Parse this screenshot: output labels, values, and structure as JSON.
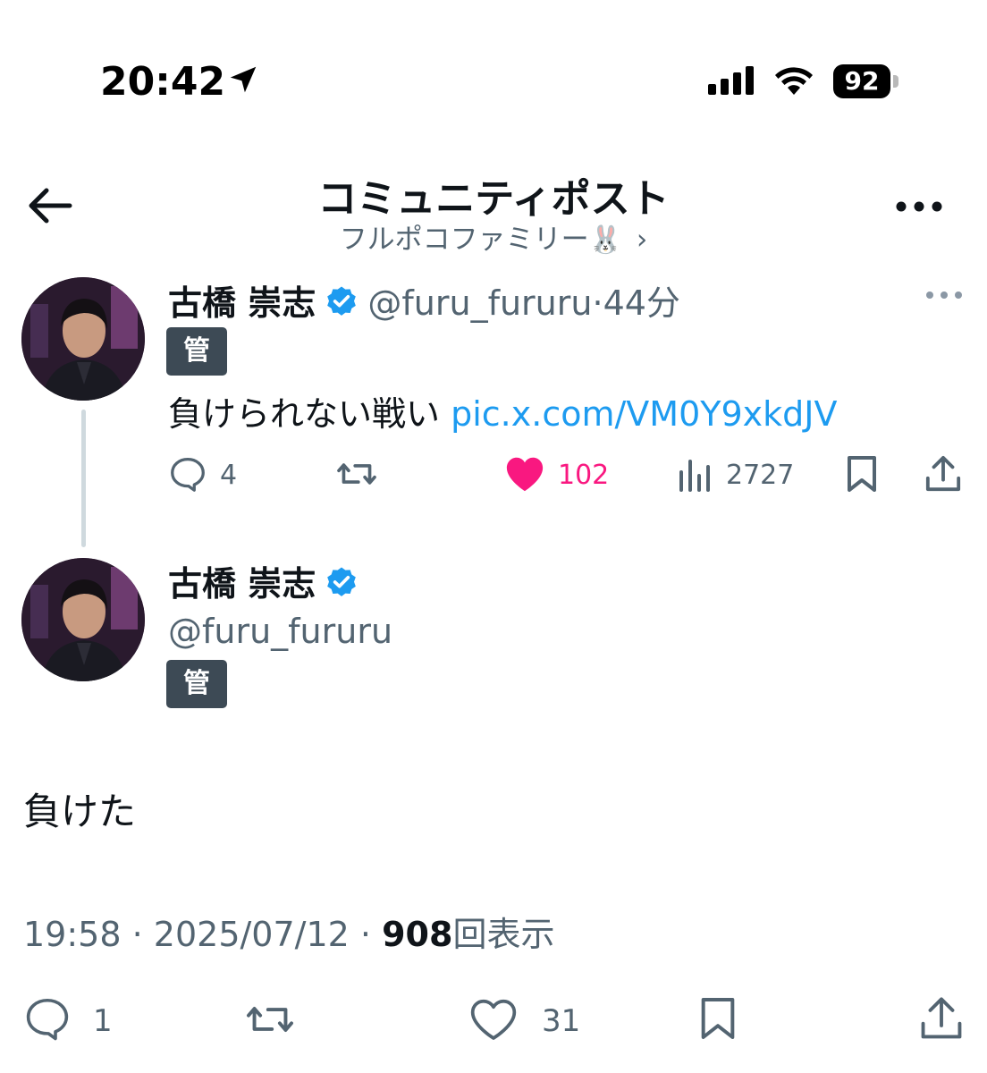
{
  "status_bar": {
    "time": "20:42",
    "battery": "92",
    "icons": [
      "location-arrow-icon",
      "signal-icon",
      "wifi-icon"
    ]
  },
  "header": {
    "title": "コミュニティポスト",
    "subtitle": "フルポコファミリー",
    "subtitle_emoji": "🐰",
    "chevron": "›",
    "icons": [
      "back-arrow-icon",
      "more-icon"
    ]
  },
  "parent_post": {
    "name": "古橋 崇志",
    "handle": "@furu_fururu",
    "separator": "·",
    "time_ago": "44分",
    "badge": "管",
    "text": "負けられない戦い",
    "link": "pic.x.com/VM0Y9xkdJV",
    "replies": "4",
    "retweets": "",
    "likes": "102",
    "views": "2727",
    "liked": true
  },
  "main_post": {
    "name": "古橋 崇志",
    "handle": "@furu_fururu",
    "badge": "管",
    "text": "負けた",
    "time": "19:58",
    "date": "2025/07/12",
    "separator": "·",
    "view_count": "908",
    "view_label": "回表示",
    "replies": "1",
    "retweets": "",
    "likes": "31"
  },
  "colors": {
    "text": "#0f1419",
    "muted": "#536471",
    "link": "#1d9bf0",
    "like": "#f91880",
    "verified": "#1d9bf0",
    "mod_badge": "#3d4a55"
  }
}
